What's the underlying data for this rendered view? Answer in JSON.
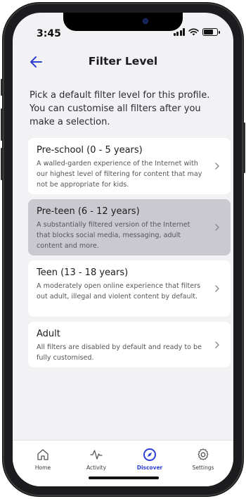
{
  "status_bar": {
    "time": "3:45"
  },
  "header": {
    "title": "Filter Level",
    "back_icon": "arrow-left-icon"
  },
  "intro": "Pick a default filter level for this profile. You can customise all filters after you make a selection.",
  "options": [
    {
      "title": "Pre-school (0 - 5 years)",
      "description": "A walled-garden experience of the Internet with our highest level of filtering for content that may not be appropriate for kids.",
      "selected": false
    },
    {
      "title": "Pre-teen (6 - 12 years)",
      "description": "A substantially filtered version of the Internet that blocks social media, messaging, adult content and more.",
      "selected": true
    },
    {
      "title": "Teen (13 - 18 years)",
      "description": "A moderately open online experience that filters out adult, illegal and violent content by default.",
      "selected": false
    },
    {
      "title": "Adult",
      "description": "All filters are disabled by default and ready to be fully customised.",
      "selected": false
    }
  ],
  "tabs": [
    {
      "label": "Home",
      "icon": "home-icon",
      "active": false
    },
    {
      "label": "Activity",
      "icon": "activity-icon",
      "active": false
    },
    {
      "label": "Discover",
      "icon": "compass-icon",
      "active": true
    },
    {
      "label": "Settings",
      "icon": "gear-icon",
      "active": false
    }
  ],
  "colors": {
    "accent": "#2e3fd4",
    "background": "#f2f1f4",
    "selected_card": "#cbc9d0",
    "card": "#ffffff"
  }
}
